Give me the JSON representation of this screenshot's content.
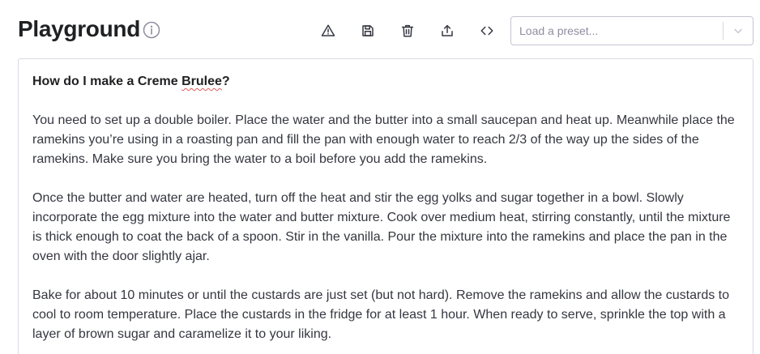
{
  "header": {
    "title": "Playground",
    "icons": {
      "info": "info-circle-icon",
      "warning": "warning-triangle-icon",
      "save": "save-floppy-icon",
      "delete": "trash-icon",
      "share": "share-upload-icon",
      "code": "code-brackets-icon"
    }
  },
  "preset": {
    "placeholder": "Load a preset..."
  },
  "editor": {
    "question_start": "How do I make a Creme ",
    "question_misspelled": "Brulee",
    "question_end": "?",
    "paragraphs": [
      "You need to set up a double boiler. Place the water and the butter into a small saucepan and heat up. Meanwhile place the ramekins you’re using in a roasting pan and fill the pan with enough water to reach 2/3 of the way up the sides of the ramekins. Make sure you bring the water to a boil before you add the ramekins.",
      "Once the butter and water are heated, turn off the heat and stir the egg yolks and sugar together in a bowl. Slowly incorporate the egg mixture into the water and butter mixture. Cook over medium heat, stirring constantly, until the mixture is thick enough to coat the back of a spoon. Stir in the vanilla. Pour the mixture into the ramekins and place the pan in the oven with the door slightly ajar.",
      "Bake for about 10 minutes or until the custards are just set (but not hard). Remove the ramekins and allow the custards to cool to room temperature. Place the custards in the fridge for at least 1 hour. When ready to serve, sprinkle the top with a layer of brown sugar and caramelize it to your liking."
    ]
  },
  "colors": {
    "text": "#353740",
    "heading": "#202123",
    "border": "#d9d9e3",
    "icon": "#353740",
    "placeholder": "#8e8ea0"
  }
}
